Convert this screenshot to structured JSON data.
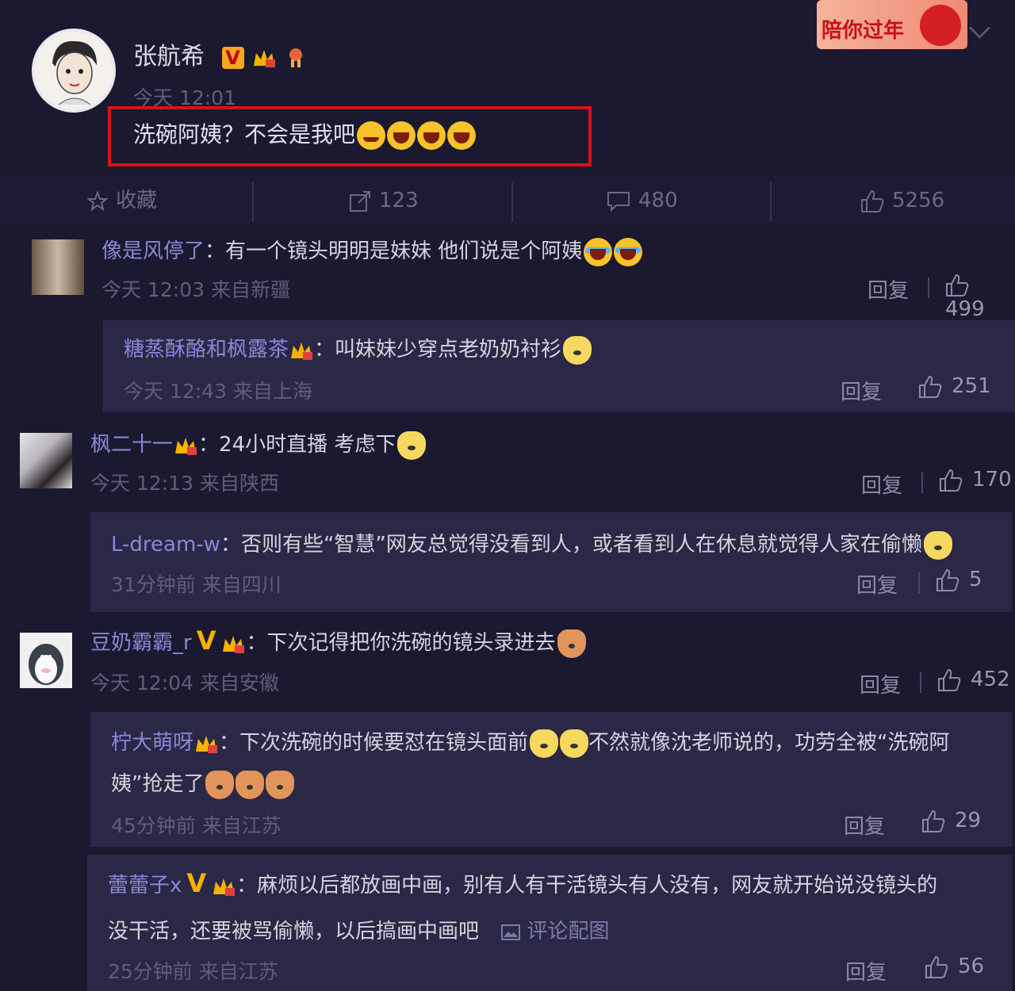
{
  "post": {
    "author": "张航希",
    "time": "今天 12:01",
    "text": "洗碗阿姨？不会是我吧",
    "banner": "陪你过年"
  },
  "actions": {
    "favorite": "收藏",
    "repost": "123",
    "comment": "480",
    "like": "5256"
  },
  "labels": {
    "reply": "回复"
  },
  "comments": [
    {
      "user": "像是风停了",
      "text": "有一个镜头明明是妹妹 他们说是个阿姨",
      "meta": "今天 12:03 来自新疆",
      "likes": "499"
    },
    {
      "user": "糖蒸酥酪和枫露茶",
      "text": "叫妹妹少穿点老奶奶衬衫",
      "meta": "今天 12:43 来自上海",
      "likes": "251"
    },
    {
      "user": "枫二十一",
      "text": "24小时直播 考虑下",
      "meta": "今天 12:13 来自陕西",
      "likes": "170"
    },
    {
      "user": "L-dream-w",
      "text": "否则有些“智慧”网友总觉得没看到人，或者看到人在休息就觉得人家在偷懒",
      "meta": "31分钟前 来自四川",
      "likes": "5"
    },
    {
      "user": "豆奶霸霸_r",
      "text": "下次记得把你洗碗的镜头录进去",
      "meta": "今天 12:04 来自安徽",
      "likes": "452"
    },
    {
      "user": "柠大萌呀",
      "text1": "下次洗碗的时候要怼在镜头面前",
      "text2": "不然就像沈老师说的，功劳全被“洗碗阿",
      "text3": "姨”抢走了",
      "meta": "45分钟前 来自江苏",
      "likes": "29"
    },
    {
      "user": "蕾蕾子x",
      "text1": "麻烦以后都放画中画，别有人有干活镜头有人没有，网友就开始说没镜头的",
      "text2": "没干活，还要被骂偷懒，以后搞画中画吧",
      "pic_label": "评论配图",
      "meta": "25分钟前 来自江苏",
      "likes": "56"
    }
  ]
}
